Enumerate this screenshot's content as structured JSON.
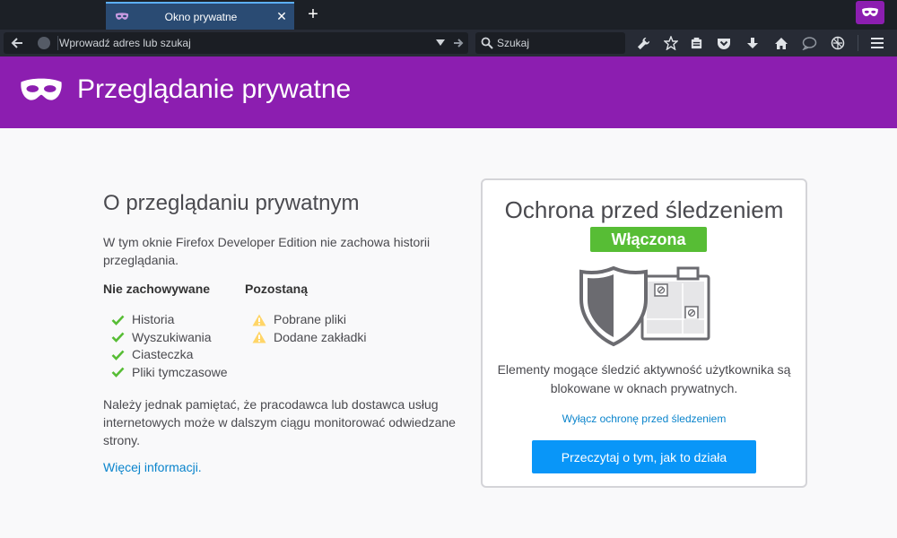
{
  "tab": {
    "title": "Okno prywatne"
  },
  "navbar": {
    "url_placeholder": "Wprowadź adres lub szukaj",
    "search_placeholder": "Szukaj"
  },
  "banner": {
    "title": "Przeglądanie prywatne"
  },
  "about": {
    "title": "O przeglądaniu prywatnym",
    "description": "W tym oknie Firefox Developer Edition nie zachowa historii przeglądania.",
    "not_saved": {
      "heading": "Nie zachowywane",
      "items": [
        "Historia",
        "Wyszukiwania",
        "Ciasteczka",
        "Pliki tymczasowe"
      ]
    },
    "saved": {
      "heading": "Pozostaną",
      "items": [
        "Pobrane pliki",
        "Dodane zakładki"
      ]
    },
    "note": "Należy jednak pamiętać, że pracodawca lub dostawca usług internetowych może w dalszym ciągu monitorować odwiedzane strony.",
    "more_link": "Więcej informacji."
  },
  "tracking": {
    "title": "Ochrona przed śledzeniem",
    "status": "Włączona",
    "description": "Elementy mogące śledzić aktywność użytkownika są blokowane w oknach prywatnych.",
    "disable_link": "Wyłącz ochronę przed śledzeniem",
    "button": "Przeczytaj o tym, jak to działa"
  },
  "colors": {
    "private_purple": "#8c1eb0",
    "status_green": "#57bd35",
    "link_blue": "#0a84cc",
    "button_blue": "#0996f8",
    "check_green": "#57bd35",
    "warning_yellow": "#ffd567"
  },
  "icons": [
    "mask-icon",
    "close-icon",
    "plus-icon",
    "back-arrow-icon",
    "globe-icon",
    "dropdown-arrow-icon",
    "go-arrow-icon",
    "search-icon",
    "wrench-icon",
    "star-icon",
    "reading-list-icon",
    "pocket-icon",
    "download-icon",
    "home-icon",
    "chat-icon",
    "tracking-protection-icon",
    "hamburger-menu-icon",
    "check-icon",
    "warning-icon",
    "shield-icon"
  ]
}
